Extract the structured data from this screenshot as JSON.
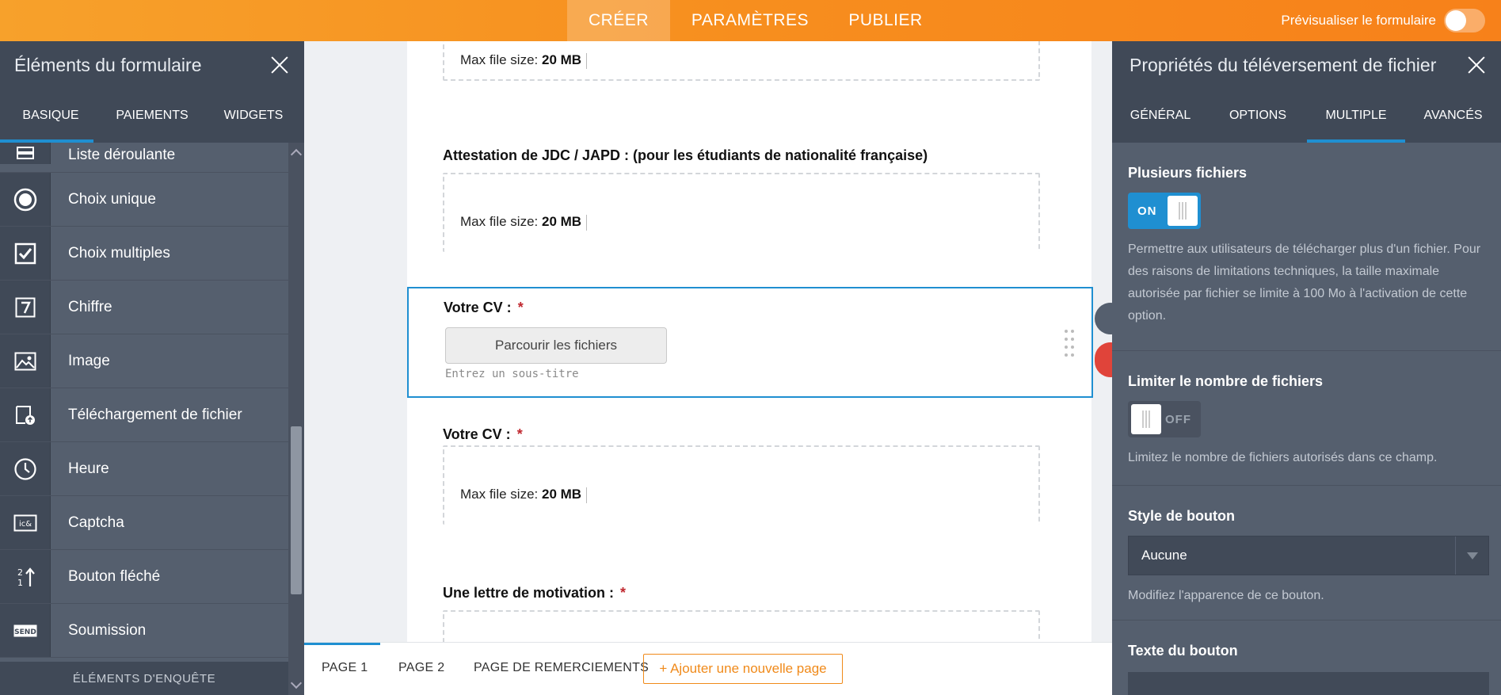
{
  "topbar": {
    "tabs": [
      "CRÉER",
      "PARAMÈTRES",
      "PUBLIER"
    ],
    "preview_label": "Prévisualiser le formulaire"
  },
  "left_panel": {
    "title": "Éléments du formulaire",
    "tabs": [
      "BASIQUE",
      "PAIEMENTS",
      "WIDGETS"
    ],
    "items": [
      {
        "label": "Liste déroulante",
        "icon": "dropdown-list-icon"
      },
      {
        "label": "Choix unique",
        "icon": "radio-icon"
      },
      {
        "label": "Choix multiples",
        "icon": "checkbox-icon"
      },
      {
        "label": "Chiffre",
        "icon": "number-icon"
      },
      {
        "label": "Image",
        "icon": "image-icon"
      },
      {
        "label": "Téléchargement de fichier",
        "icon": "file-upload-icon"
      },
      {
        "label": "Heure",
        "icon": "clock-icon"
      },
      {
        "label": "Captcha",
        "icon": "captcha-icon"
      },
      {
        "label": "Bouton fléché",
        "icon": "arrow-button-icon"
      },
      {
        "label": "Soumission",
        "icon": "send-icon"
      }
    ],
    "footer": "ÉLÉMENTS D'ENQUÊTE"
  },
  "canvas": {
    "upload_prefix": "Max file size:",
    "upload_size": "20 MB",
    "q1_label": "Attestation de JDC / JAPD : (pour les étudiants de nationalité française)",
    "q2_label": "Votre CV :",
    "q2_required": "*",
    "browse_label": "Parcourir les fichiers",
    "subtitle_placeholder": "Entrez un sous-titre",
    "q3_label": "Votre CV :",
    "q3_required": "*",
    "q4_label": "Une lettre de motivation :",
    "q4_required": "*"
  },
  "pages": {
    "tabs": [
      "PAGE 1",
      "PAGE 2",
      "PAGE DE REMERCIEMENTS"
    ],
    "add_page": "+ Ajouter une nouvelle page"
  },
  "right_panel": {
    "title": "Propriétés du téléversement de fichier",
    "tabs": [
      "GÉNÉRAL",
      "OPTIONS",
      "MULTIPLE",
      "AVANCÉS"
    ],
    "multi_title": "Plusieurs fichiers",
    "multi_switch": "ON",
    "multi_desc": "Permettre aux utilisateurs de télécharger plus d'un fichier. Pour des raisons de limitations techniques, la taille maximale autorisée par fichier se limite à 100 Mo à l'activation de cette option.",
    "limit_title": "Limiter le nombre de fichiers",
    "limit_switch": "OFF",
    "limit_desc": "Limitez le nombre de fichiers autorisés dans ce champ.",
    "style_title": "Style de bouton",
    "style_value": "Aucune",
    "style_desc": "Modifiez l'apparence de ce bouton.",
    "text_title": "Texte du bouton"
  },
  "colors": {
    "accent_orange": "#f7941d",
    "accent_blue": "#1f8fd1",
    "panel_dark": "#404957",
    "panel": "#555f6e",
    "required_red": "#c0282f"
  }
}
